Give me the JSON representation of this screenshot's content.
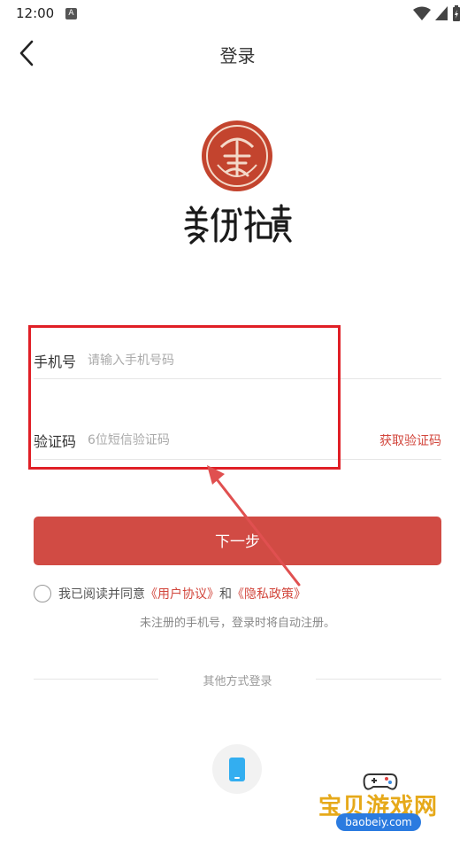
{
  "status_bar": {
    "time": "12:00",
    "notification_icon_letter": "A"
  },
  "header": {
    "title": "登录"
  },
  "logo": {
    "name": "美術拍賣"
  },
  "form": {
    "phone": {
      "label": "手机号",
      "placeholder": "请输入手机号码",
      "value": ""
    },
    "code": {
      "label": "验证码",
      "placeholder": "6位短信验证码",
      "value": "",
      "get_code_label": "获取验证码"
    }
  },
  "next_button": {
    "label": "下一步"
  },
  "agreement": {
    "prefix": "我已阅读并同意",
    "user_agreement": "《用户协议》",
    "and": "和",
    "privacy_policy": "《隐私政策》",
    "checked": false
  },
  "register_note": "未注册的手机号，登录时将自动注册。",
  "other_login": {
    "heading": "其他方式登录",
    "icon": "phone-icon"
  },
  "watermark": {
    "text": "宝贝游戏网",
    "url": "baobeiy.com"
  },
  "colors": {
    "accent": "#d14b44",
    "link": "#d2463c",
    "highlight_box": "#e01f26",
    "seal": "#c3442e",
    "phone_icon": "#33aef0"
  }
}
